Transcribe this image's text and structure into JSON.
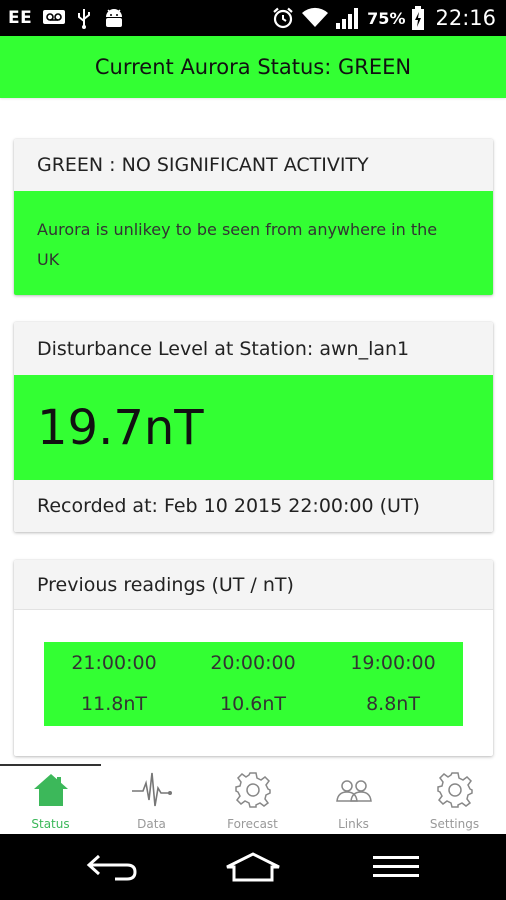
{
  "status_bar": {
    "carrier": "EE",
    "battery_percent": "75%",
    "time": "22:16"
  },
  "header": {
    "title": "Current Aurora Status: GREEN"
  },
  "status_card": {
    "heading": "GREEN : NO SIGNIFICANT ACTIVITY",
    "description": "Aurora is unlikey to be seen from anywhere in the UK"
  },
  "disturbance_card": {
    "heading": "Disturbance Level at Station: awn_lan1",
    "reading": "19.7nT",
    "recorded": "Recorded at: Feb 10 2015 22:00:00 (UT)"
  },
  "previous_card": {
    "heading": "Previous readings (UT / nT)",
    "readings": [
      {
        "time": "21:00:00",
        "value": "11.8nT"
      },
      {
        "time": "20:00:00",
        "value": "10.6nT"
      },
      {
        "time": "19:00:00",
        "value": "8.8nT"
      }
    ]
  },
  "bottom_nav": {
    "items": [
      {
        "label": "Status",
        "icon": "home-icon",
        "active": true
      },
      {
        "label": "Data",
        "icon": "pulse-icon",
        "active": false
      },
      {
        "label": "Forecast",
        "icon": "gear-icon",
        "active": false
      },
      {
        "label": "Links",
        "icon": "people-icon",
        "active": false
      },
      {
        "label": "Settings",
        "icon": "gear-icon",
        "active": false
      }
    ]
  },
  "colors": {
    "status_green": "#33ff33",
    "active_tab": "#3cb85a",
    "inactive_tab": "#999999"
  }
}
